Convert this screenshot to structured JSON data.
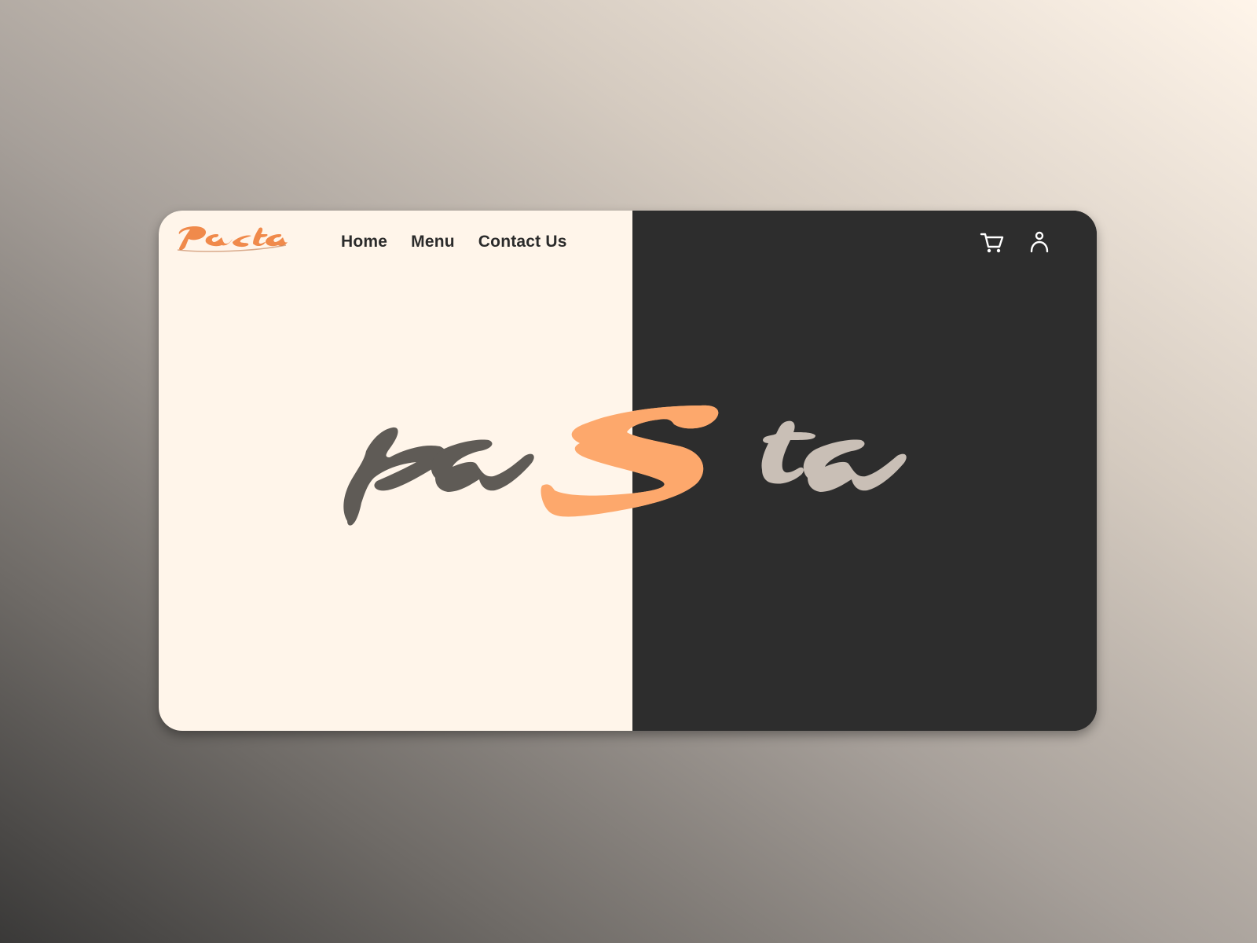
{
  "brand": {
    "logo_text": "Pasta",
    "accent_color": "#f08a4b"
  },
  "nav": {
    "items": [
      {
        "label": "Home"
      },
      {
        "label": "Menu"
      },
      {
        "label": "Contact Us"
      }
    ]
  },
  "header_icons": {
    "cart": "cart-icon",
    "user": "user-icon"
  },
  "hero": {
    "word": "paSta",
    "parts": [
      "pa",
      "S",
      "ta"
    ],
    "colors": {
      "left_bg": "#fff5ea",
      "right_bg": "#2d2d2d",
      "pa_color": "#5f5b56",
      "s_color": "#fda86c",
      "s_overlay_color": "#c87440",
      "ta_color": "#c9bfb6"
    }
  }
}
